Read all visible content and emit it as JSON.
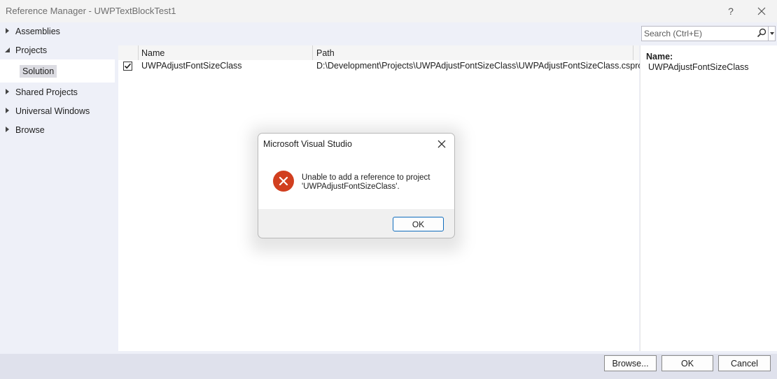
{
  "window": {
    "title": "Reference Manager - UWPTextBlockTest1",
    "help_glyph": "?",
    "close_glyph": "✕"
  },
  "tree": {
    "assemblies": "Assemblies",
    "projects": "Projects",
    "solution": "Solution",
    "shared_projects": "Shared Projects",
    "universal_windows": "Universal Windows",
    "browse": "Browse"
  },
  "search": {
    "placeholder": "Search (Ctrl+E)"
  },
  "grid": {
    "columns": {
      "name": "Name",
      "path": "Path"
    },
    "rows": [
      {
        "checked": true,
        "name": "UWPAdjustFontSizeClass",
        "path": "D:\\Development\\Projects\\UWPAdjustFontSizeClass\\UWPAdjustFontSizeClass.csproj"
      }
    ]
  },
  "details": {
    "label": "Name:",
    "value": "UWPAdjustFontSizeClass"
  },
  "footer": {
    "browse_label": "Browse...",
    "ok_label": "OK",
    "cancel_label": "Cancel"
  },
  "dialog": {
    "title": "Microsoft Visual Studio",
    "message_line1": "Unable to add a reference to project",
    "message_line2": "'UWPAdjustFontSizeClass'.",
    "ok_label": "OK"
  },
  "colors": {
    "error": "#d13f1f",
    "accent": "#0f6cbd"
  },
  "icons": {
    "error": "error-icon",
    "search": "search-icon",
    "close": "close-icon",
    "check": "check-icon"
  }
}
